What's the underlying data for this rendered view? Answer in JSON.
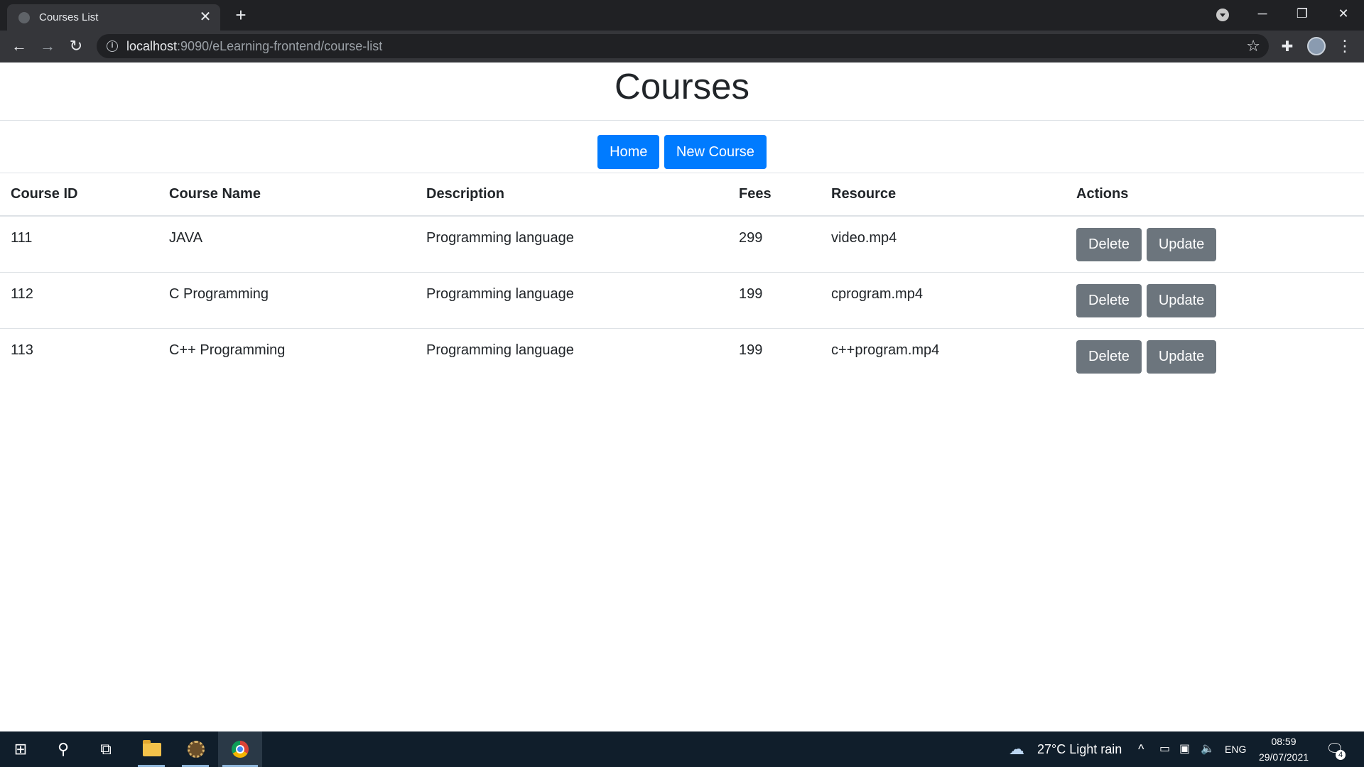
{
  "browser": {
    "tab_title": "Courses List",
    "url_host": "localhost",
    "url_path": ":9090/eLearning-frontend/course-list"
  },
  "page": {
    "title": "Courses",
    "home_label": "Home",
    "new_course_label": "New Course"
  },
  "table": {
    "headers": [
      "Course ID",
      "Course Name",
      "Description",
      "Fees",
      "Resource",
      "Actions"
    ],
    "rows": [
      {
        "id": "111",
        "name": "JAVA",
        "description": "Programming language",
        "fees": "299",
        "resource": "video.mp4"
      },
      {
        "id": "112",
        "name": "C Programming",
        "description": "Programming language",
        "fees": "199",
        "resource": "cprogram.mp4"
      },
      {
        "id": "113",
        "name": "C++ Programming",
        "description": "Programming language",
        "fees": "199",
        "resource": "c++program.mp4"
      }
    ],
    "delete_label": "Delete",
    "update_label": "Update"
  },
  "taskbar": {
    "weather": "27°C  Light rain",
    "language": "ENG",
    "time": "08:59",
    "date": "29/07/2021",
    "notifications": "4"
  },
  "colors": {
    "primary": "#007bff",
    "secondary": "#6c757d",
    "chrome_dark": "#202124",
    "taskbar": "#101e2b"
  }
}
